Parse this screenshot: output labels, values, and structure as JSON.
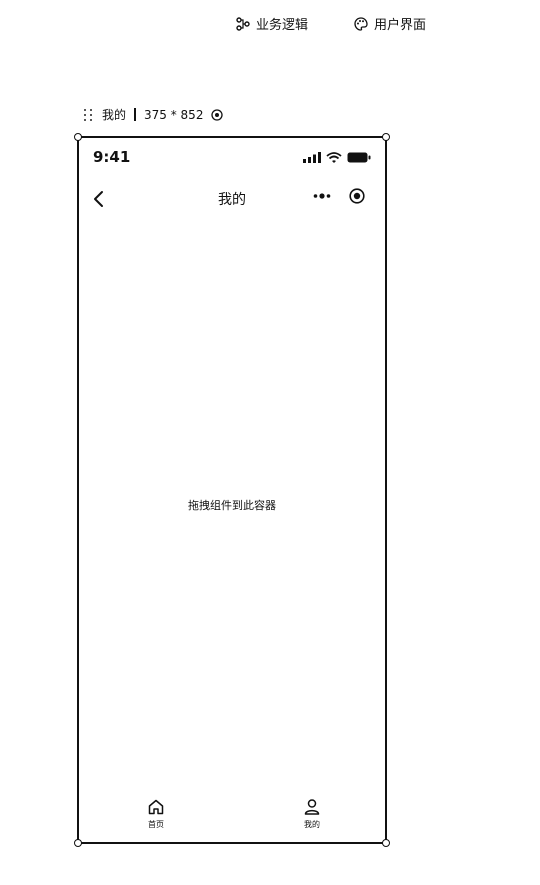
{
  "toolbar": {
    "tabs": [
      {
        "label": "业务逻辑",
        "icon": "flow-icon"
      },
      {
        "label": "用户界面",
        "icon": "palette-icon"
      }
    ]
  },
  "page_meta": {
    "name": "我的",
    "size": "375 * 852"
  },
  "phone": {
    "status": {
      "time": "9:41",
      "icons": [
        "signal-icon",
        "wifi-icon",
        "battery-icon"
      ]
    },
    "nav": {
      "title": "我的"
    },
    "placeholder": "拖拽组件到此容器",
    "tabbar": {
      "items": [
        {
          "label": "首页",
          "icon": "home-icon"
        },
        {
          "label": "我的",
          "icon": "user-icon"
        }
      ]
    }
  }
}
